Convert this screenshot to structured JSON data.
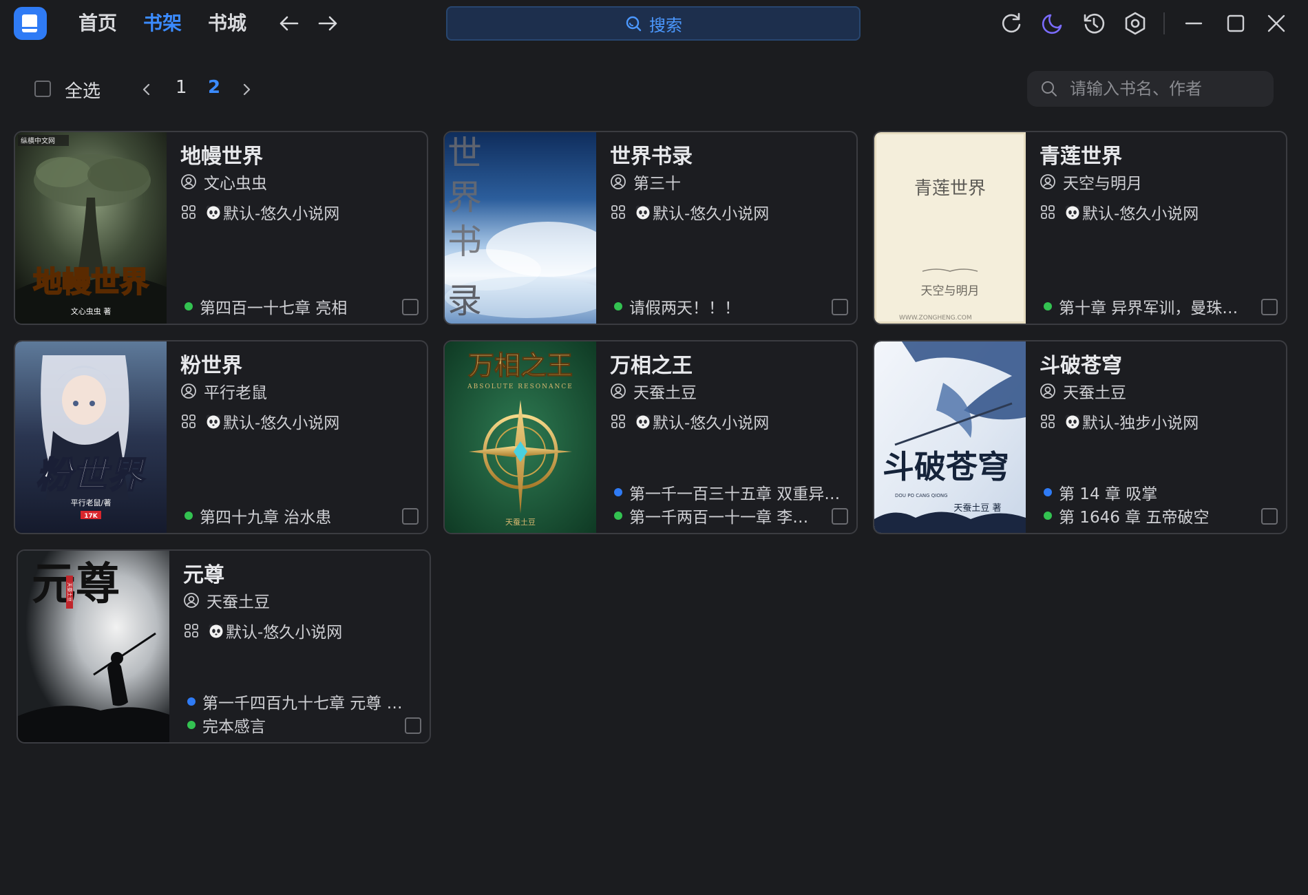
{
  "nav": {
    "home": "首页",
    "shelf": "书架",
    "store": "书城",
    "search_label": "搜索"
  },
  "toolbar": {
    "select_all": "全选",
    "pages": [
      "1",
      "2"
    ],
    "current_page": "2",
    "filter_placeholder": "请输入书名、作者"
  },
  "books": [
    {
      "title": "地幔世界",
      "author": "文心虫虫",
      "source": "默认-悠久小说网",
      "chapters": [
        {
          "text": "第四百一十七章 亮相",
          "status": "green"
        }
      ]
    },
    {
      "title": "世界书录",
      "author": "第三十",
      "source": "默认-悠久小说网",
      "chapters": [
        {
          "text": "请假两天！！！",
          "status": "green"
        }
      ]
    },
    {
      "title": "青莲世界",
      "author": "天空与明月",
      "source": "默认-悠久小说网",
      "chapters": [
        {
          "text": "第十章 异界军训，曼珠…",
          "status": "green"
        }
      ]
    },
    {
      "title": "粉世界",
      "author": "平行老鼠",
      "source": "默认-悠久小说网",
      "chapters": [
        {
          "text": "第四十九章 治水患",
          "status": "green"
        }
      ]
    },
    {
      "title": "万相之王",
      "author": "天蚕土豆",
      "source": "默认-悠久小说网",
      "chapters": [
        {
          "text": "第一千一百三十五章 双重异…",
          "status": "blue"
        },
        {
          "text": "第一千两百一十一章 李…",
          "status": "green"
        }
      ]
    },
    {
      "title": "斗破苍穹",
      "author": "天蚕土豆",
      "source": "默认-独步小说网",
      "chapters": [
        {
          "text": "第 14 章 吸掌",
          "status": "blue"
        },
        {
          "text": "第 1646 章 五帝破空",
          "status": "green"
        }
      ]
    },
    {
      "title": "元尊",
      "author": "天蚕土豆",
      "source": "默认-悠久小说网",
      "chapters": [
        {
          "text": "第一千四百九十七章 元尊 …",
          "status": "blue"
        },
        {
          "text": "完本感言",
          "status": "green"
        }
      ]
    }
  ],
  "covers": {
    "c1": {
      "main": "地幔世界",
      "sub": "文心虫虫 著",
      "badge": "纵横中文网"
    },
    "c2": {
      "vertical": [
        "世",
        "界",
        "书",
        "录"
      ]
    },
    "c3": {
      "main": "青莲世界",
      "author": "天空与明月",
      "site": "WWW.ZONGHENG.COM"
    },
    "c4": {
      "main": "粉世界",
      "sub": "平行老鼠/著",
      "badge": "17K"
    },
    "c5": {
      "main": "万相之王",
      "sub": "ABSOLUTE RESONANCE",
      "author": "天蚕土豆"
    },
    "c6": {
      "main": "斗破苍穹",
      "pinyin": "DOU PO CANG QIONG",
      "author": "天蚕土豆 著"
    },
    "c7": {
      "main": "元尊",
      "seal": "天蚕土豆"
    }
  },
  "colors": {
    "accent": "#3b8bff",
    "status_green": "#33c251",
    "status_blue": "#2f7bf5",
    "moon_purple": "#7b6cff"
  }
}
